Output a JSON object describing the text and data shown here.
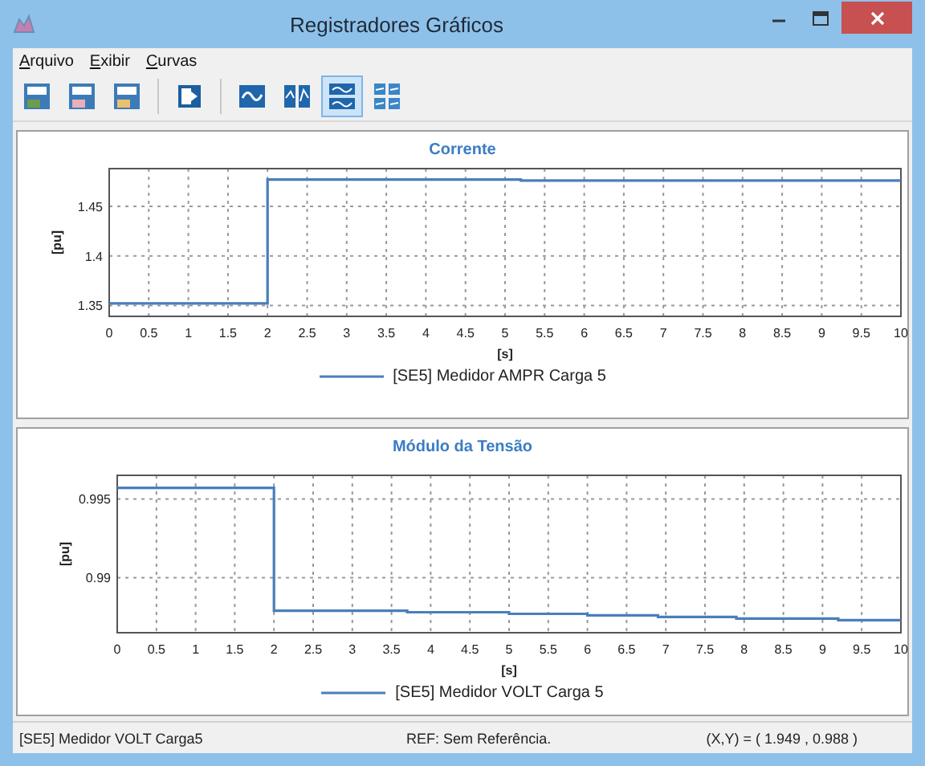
{
  "window": {
    "title": "Registradores Gráficos"
  },
  "menu": [
    "Arquivo",
    "Exibir",
    "Curvas"
  ],
  "toolbar": [
    [
      {
        "kind": "save-data",
        "selected": false
      },
      {
        "kind": "save-chart",
        "selected": false
      },
      {
        "kind": "save-image",
        "selected": false
      }
    ],
    [
      {
        "kind": "export",
        "selected": false
      }
    ],
    [
      {
        "kind": "single-curve",
        "selected": false
      },
      {
        "kind": "dual-curve",
        "selected": false
      },
      {
        "kind": "stacked-curves",
        "selected": true
      },
      {
        "kind": "grid-curves",
        "selected": false
      }
    ]
  ],
  "charts": [
    {
      "chart_data": {
        "type": "line",
        "title": "Corrente",
        "xlabel": "[s]",
        "ylabel": "[pu]",
        "xlim": [
          0,
          10
        ],
        "ylim": [
          1.339,
          1.488
        ],
        "xticks": [
          0,
          0.5,
          1,
          1.5,
          2,
          2.5,
          3,
          3.5,
          4,
          4.5,
          5,
          5.5,
          6,
          6.5,
          7,
          7.5,
          8,
          8.5,
          9,
          9.5,
          10
        ],
        "yticks": [
          1.35,
          1.4,
          1.45
        ],
        "x": [
          0,
          2,
          2,
          5.2,
          5.2,
          10
        ],
        "grid": true,
        "series": [
          {
            "name": "[SE5] Medidor AMPR Carga 5",
            "color": "#4a7ebb",
            "values": [
              1.352,
              1.352,
              1.477,
              1.477,
              1.476,
              1.476
            ]
          }
        ]
      }
    },
    {
      "chart_data": {
        "type": "line",
        "title": "Módulo da Tensão",
        "xlabel": "[s]",
        "ylabel": "[pu]",
        "xlim": [
          0,
          10
        ],
        "ylim": [
          0.9865,
          0.9965
        ],
        "xticks": [
          0,
          0.5,
          1,
          1.5,
          2,
          2.5,
          3,
          3.5,
          4,
          4.5,
          5,
          5.5,
          6,
          6.5,
          7,
          7.5,
          8,
          8.5,
          9,
          9.5,
          10
        ],
        "yticks": [
          0.99,
          0.995
        ],
        "x": [
          0,
          2,
          2,
          3.7,
          3.7,
          5,
          5,
          6,
          6,
          6.9,
          6.9,
          7.9,
          7.9,
          9.2,
          9.2,
          10
        ],
        "grid": true,
        "series": [
          {
            "name": "[SE5] Medidor VOLT Carga 5",
            "color": "#4a7ebb",
            "values": [
              0.9957,
              0.9957,
              0.9879,
              0.9879,
              0.9878,
              0.9878,
              0.9877,
              0.9877,
              0.9876,
              0.9876,
              0.9875,
              0.9875,
              0.9874,
              0.9874,
              0.9873,
              0.9873
            ]
          }
        ]
      }
    }
  ],
  "status_bar": [
    "[SE5] Medidor VOLT Carga5",
    "REF: Sem Referência.",
    "(X,Y) = ( 1.949 , 0.988 )"
  ]
}
